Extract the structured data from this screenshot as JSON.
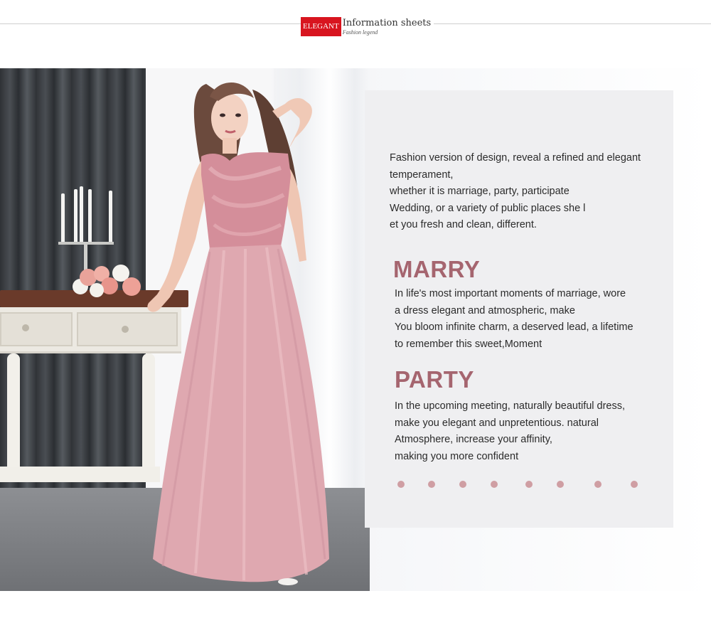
{
  "header": {
    "badge": "ELEGANT",
    "title": "Information sheets",
    "subtitle": "Fashion legend"
  },
  "intro_lines": [
    "Fashion version of design, reveal a refined and elegant",
    "temperament,",
    "whether it is marriage, party, participate",
    "Wedding, or a variety of public places she l",
    "et you fresh and clean, different."
  ],
  "sections": [
    {
      "title": "MARRY",
      "lines": [
        "In life's most important moments of marriage, wore",
        "a dress elegant and atmospheric, make",
        "You bloom infinite charm, a deserved lead, a lifetime",
        "to remember this sweet,Moment"
      ]
    },
    {
      "title": "PARTY",
      "lines": [
        "In the upcoming meeting, naturally beautiful dress,",
        "make you elegant and unpretentious. natural",
        "Atmosphere, increase your affinity,",
        "making you more confident"
      ]
    }
  ],
  "colors": {
    "badge": "#d8151f",
    "accent_title": "#a5656f",
    "dots": "#cf9ea3",
    "panel": "#efeff1",
    "dress": "#d9a3ab"
  },
  "decorative_dot_count": 8
}
